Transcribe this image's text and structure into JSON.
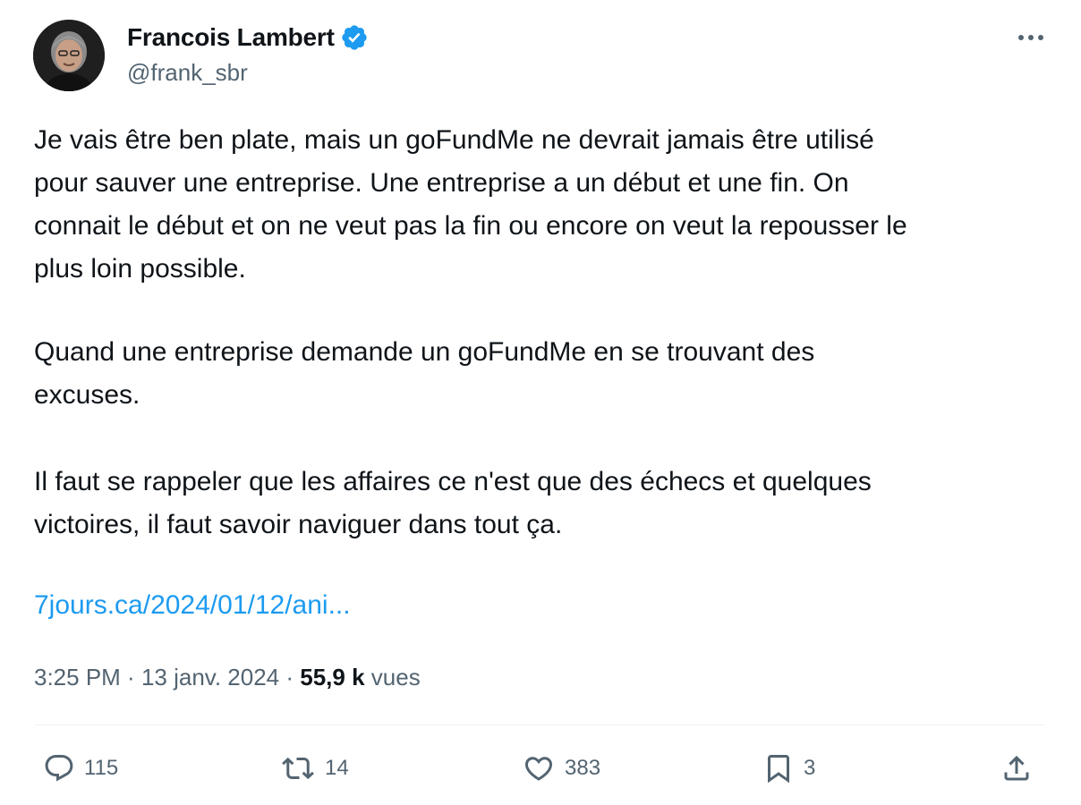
{
  "author": {
    "display_name": "Francois Lambert",
    "handle": "@frank_sbr",
    "verified": true
  },
  "tweet": {
    "paragraphs": [
      "Je vais être ben plate, mais un goFundMe ne devrait jamais être utilisé\npour sauver une entreprise. Une entreprise a un début et une fin. On\nconnait le début et on ne veut pas la fin ou encore on veut la repousser le\nplus loin possible.",
      "Quand une entreprise demande un goFundMe en se trouvant des\nexcuses.",
      "Il faut se rappeler que les affaires ce n'est que des échecs et quelques\nvictoires, il faut savoir naviguer dans tout ça."
    ],
    "link_text": "7jours.ca/2024/01/12/ani...",
    "time": "3:25 PM",
    "date": "13 janv. 2024",
    "separator": " · ",
    "views_count": "55,9 k",
    "views_label": "vues"
  },
  "actions": {
    "replies": "115",
    "reposts": "14",
    "likes": "383",
    "bookmarks": "3"
  },
  "icons": {
    "verified": "verified-badge-icon",
    "more": "more-dots-icon",
    "reply": "reply-bubble-icon",
    "repost": "repost-arrows-icon",
    "like": "heart-icon",
    "bookmark": "bookmark-icon",
    "share": "share-upload-icon"
  },
  "colors": {
    "accent": "#1d9bf0",
    "text": "#0f1419",
    "secondary": "#536471",
    "divider": "#eff3f4"
  }
}
